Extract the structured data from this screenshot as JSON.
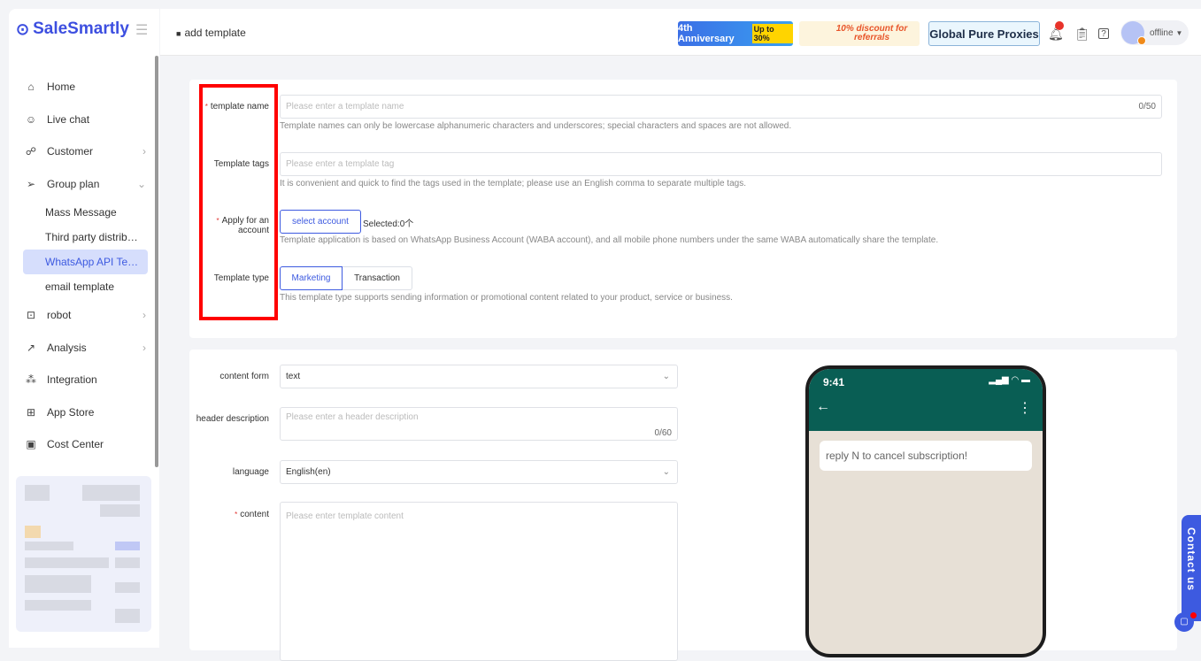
{
  "app": {
    "brand": "SaleSmartly"
  },
  "header": {
    "breadcrumb": "add template",
    "banners": [
      {
        "text": "4th Anniversary",
        "badge": "Up to 30%"
      },
      {
        "text": "10% discount for referrals"
      },
      {
        "text": "Global Pure Proxies"
      }
    ],
    "status": "offline"
  },
  "sidebar": {
    "items": [
      {
        "label": "Home",
        "icon": "home-icon"
      },
      {
        "label": "Live chat",
        "icon": "chat-icon"
      },
      {
        "label": "Customer",
        "icon": "users-icon"
      },
      {
        "label": "Group plan",
        "icon": "send-icon"
      },
      {
        "label": "robot",
        "icon": "robot-icon"
      },
      {
        "label": "Analysis",
        "icon": "chart-icon"
      },
      {
        "label": "Integration",
        "icon": "integration-icon"
      },
      {
        "label": "App Store",
        "icon": "grid-icon"
      },
      {
        "label": "Cost Center",
        "icon": "wallet-icon"
      }
    ],
    "group_plan_sub": [
      "Mass Message",
      "Third party distrib…",
      "WhatsApp API Te…",
      "email template"
    ]
  },
  "form": {
    "name": {
      "label": "template name",
      "placeholder": "Please enter a template name",
      "count": "0/50",
      "hint": "Template names can only be lowercase alphanumeric characters and underscores; special characters and spaces are not allowed."
    },
    "tags": {
      "label": "Template tags",
      "placeholder": "Please enter a template tag",
      "hint": "It is convenient and quick to find the tags used in the template; please use an English comma to separate multiple tags."
    },
    "account": {
      "label": "Apply for an account",
      "button": "select account",
      "selected": "Selected:0个",
      "hint": "Template application is based on WhatsApp Business Account (WABA account), and all mobile phone numbers under the same WABA automatically share the template."
    },
    "type": {
      "label": "Template type",
      "options": [
        "Marketing",
        "Transaction"
      ],
      "selected": "Marketing",
      "hint": "This template type supports sending information or promotional content related to your product, service or business."
    },
    "content_form": {
      "label": "content form",
      "value": "text"
    },
    "header_desc": {
      "label": "header description",
      "placeholder": "Please enter a header description",
      "count": "0/60"
    },
    "language": {
      "label": "language",
      "value": "English(en)"
    },
    "content": {
      "label": "content",
      "placeholder": "Please enter template content"
    }
  },
  "preview": {
    "time": "9:41",
    "message": "reply N to cancel subscription!"
  },
  "contact": {
    "label": "Contact us"
  }
}
